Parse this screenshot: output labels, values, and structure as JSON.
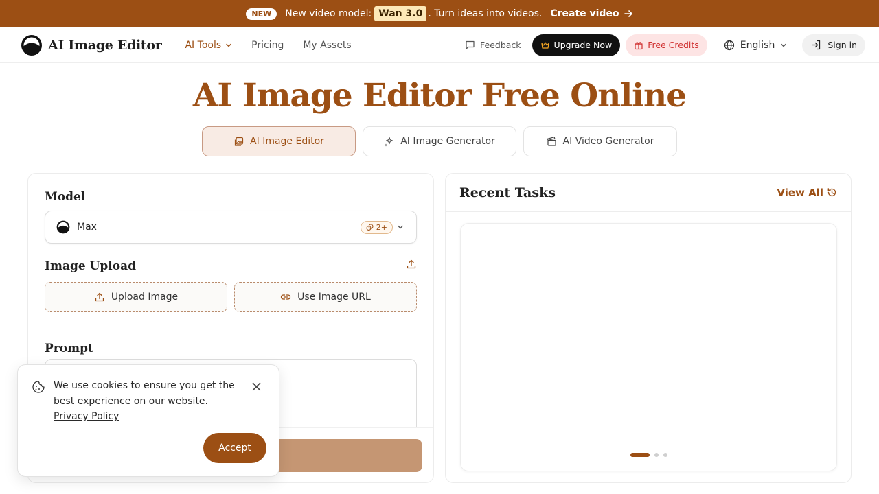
{
  "banner": {
    "badge": "NEW",
    "text_before": "New video model:",
    "model": "Wan 3.0",
    "text_after": ". Turn ideas into videos.",
    "cta": "Create video"
  },
  "nav": {
    "logo_text": "AI Image Editor",
    "links": [
      "AI Tools",
      "Pricing",
      "My Assets"
    ],
    "feedback": "Feedback",
    "upgrade": "Upgrade Now",
    "credits": "Free Credits",
    "language": "English",
    "signin": "Sign in"
  },
  "hero": {
    "title": "AI Image Editor Free Online",
    "tabs": [
      "AI Image Editor",
      "AI Image Generator",
      "AI Video Generator"
    ],
    "active_tab": 0
  },
  "form": {
    "model_label": "Model",
    "model_value": "Max",
    "model_cost": "2+",
    "upload_label": "Image Upload",
    "upload_button": "Upload Image",
    "url_button": "Use Image URL",
    "prompt_label": "Prompt",
    "generate_visible": "2"
  },
  "recent": {
    "title": "Recent Tasks",
    "view_all": "View All",
    "carousel_pages": 3,
    "carousel_active": 0
  },
  "cookie": {
    "text": "We use cookies to ensure you get the best experience on our website.",
    "link": "Privacy Policy",
    "accept": "Accept"
  },
  "colors": {
    "brand": "#9c4f14",
    "generate_button": "#c59673",
    "upgrade_bg": "#111111",
    "credits_bg": "#fde4e4",
    "credits_text": "#d03030"
  },
  "icons": [
    "crown-icon",
    "gift-icon",
    "globe-icon",
    "sign-in-icon",
    "message-icon",
    "sparkles-icon",
    "clapperboard-icon",
    "images-icon",
    "upload-icon",
    "link-icon",
    "history-icon",
    "cookie-icon",
    "close-icon",
    "chevron-down-icon",
    "arrow-right-icon",
    "coin-icon"
  ]
}
